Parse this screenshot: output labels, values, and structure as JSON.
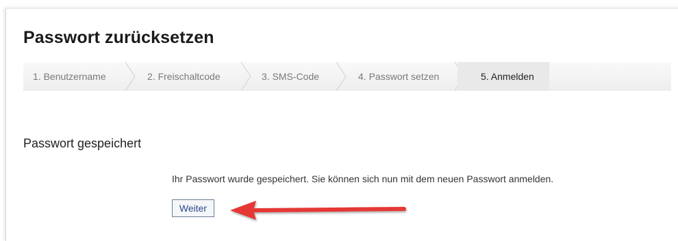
{
  "header": {
    "title": "Passwort zurücksetzen"
  },
  "wizard": {
    "steps": [
      {
        "label": "1. Benutzername",
        "active": false
      },
      {
        "label": "2. Freischaltcode",
        "active": false
      },
      {
        "label": "3. SMS-Code",
        "active": false
      },
      {
        "label": "4. Passwort setzen",
        "active": false
      },
      {
        "label": "5. Anmelden",
        "active": true
      }
    ]
  },
  "content": {
    "section_title": "Passwort gespeichert",
    "message": "Ihr Passwort wurde gespeichert. Sie können sich nun mit dem neuen Passwort anmelden.",
    "continue_label": "Weiter"
  },
  "annotation": {
    "arrow_color": "#e53935"
  }
}
